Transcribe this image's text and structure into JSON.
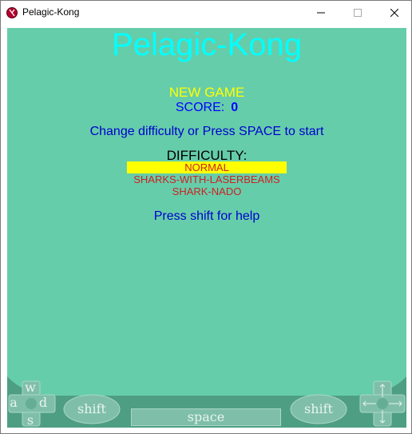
{
  "window": {
    "title": "Pelagic-Kong",
    "controls": {
      "minimize_icon": "minimize-icon",
      "maximize_icon": "maximize-icon",
      "close_icon": "close-icon"
    }
  },
  "game": {
    "title": "Pelagic-Kong",
    "status": "NEW GAME",
    "score_label": "SCORE:",
    "score_value": "0",
    "instructions": "Change difficulty or Press SPACE to start",
    "difficulty_heading": "DIFFICULTY:",
    "difficulty_options": [
      "NORMAL",
      "SHARKS-WITH-LASERBEAMS",
      "SHARK-NADO"
    ],
    "selected_difficulty": "NORMAL",
    "help": "Press shift for help"
  },
  "controls": {
    "left_pad_keys": {
      "up": "w",
      "left": "a",
      "right": "d",
      "down": "s"
    },
    "left_shift": "shift",
    "space": "space",
    "right_shift": "shift",
    "right_pad_icon": "arrow-keys-icon"
  },
  "colors": {
    "background": "#66cdaa",
    "title": "#00ffff",
    "status": "#ffff00",
    "text": "#0000cd",
    "option": "#cc2222",
    "selected_highlight": "#ffff00",
    "control_bar": "#4e9e83"
  }
}
